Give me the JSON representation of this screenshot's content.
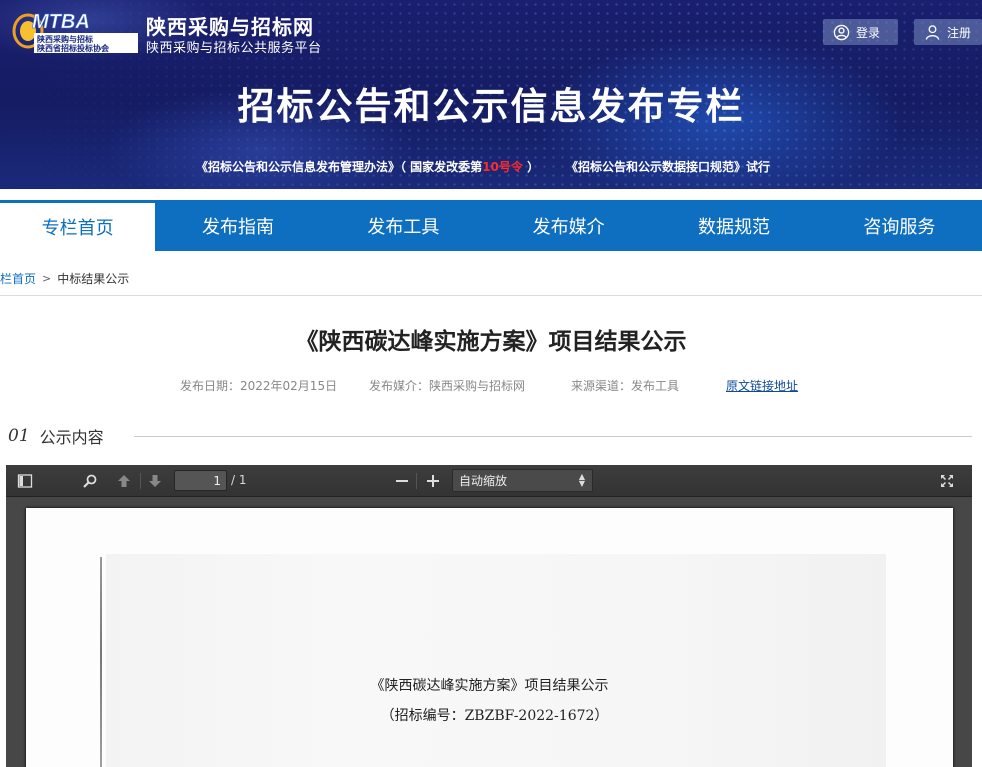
{
  "header": {
    "logo_text": "MTBA",
    "logo_sub": [
      "陕西采购与招标",
      "陕西省招标投标协会"
    ],
    "site_title": "陕西采购与招标网",
    "site_subtitle": "陕西采购与招标公共服务平台",
    "login_label": "登录",
    "register_label": "注册",
    "banner_title": "招标公告和公示信息发布专栏",
    "note1_part1": "《招标公告和公示信息发布管理办法》（ 国家发改委第",
    "note1_red": "10号令",
    "note1_part2": " ）",
    "note2": "《招标公告和公示数据接口规范》试行"
  },
  "nav": {
    "items": [
      {
        "label": "专栏首页",
        "active": true
      },
      {
        "label": "发布指南",
        "active": false
      },
      {
        "label": "发布工具",
        "active": false
      },
      {
        "label": "发布媒介",
        "active": false
      },
      {
        "label": "数据规范",
        "active": false
      },
      {
        "label": "咨询服务",
        "active": false
      }
    ]
  },
  "breadcrumb": {
    "home": "栏首页",
    "separator": ">",
    "current": "中标结果公示"
  },
  "article": {
    "title": "《陕西碳达峰实施方案》项目结果公示",
    "date": "发布日期：2022年02月15日",
    "media": "发布媒介：陕西采购与招标网",
    "source": "来源渠道：发布工具",
    "link_label": "原文链接地址"
  },
  "section": {
    "number": "01",
    "label": "公示内容"
  },
  "pdf_viewer": {
    "page_value": "1",
    "page_total": "/ 1",
    "zoom_label": "自动缩放",
    "doc_title": "《陕西碳达峰实施方案》项目结果公示",
    "doc_code": "（招标编号：ZBZBF-2022-1672）"
  },
  "colors": {
    "nav_blue": "#0e6fc0",
    "banner_navy": "#151c63",
    "highlight_red": "#ff2a2a"
  },
  "icons": [
    "user-circle-icon",
    "user-icon",
    "sidebar-toggle-icon",
    "search-icon",
    "arrow-up-icon",
    "arrow-down-icon",
    "minus-icon",
    "plus-icon",
    "fullscreen-icon"
  ]
}
